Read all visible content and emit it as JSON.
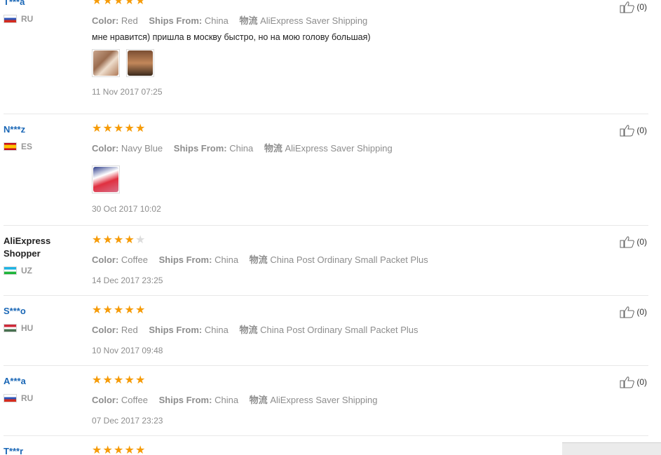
{
  "reviews": [
    {
      "user": "T***a",
      "country": "RU",
      "flag": "ru",
      "rating": 5,
      "color_label": "Color:",
      "color": "Red",
      "ships_label": "Ships From:",
      "ships": "China",
      "logistics_label": "物流",
      "logistics": "AliExpress Saver Shipping",
      "text": "мне нравится) пришла в москву быстро, но на мою голову большая)",
      "photos": [
        "photo-1",
        "photo-2"
      ],
      "date": "11 Nov 2017 07:25",
      "likes": "(0)"
    },
    {
      "user": "N***z",
      "country": "ES",
      "flag": "es",
      "rating": 5,
      "color_label": "Color:",
      "color": "Navy Blue",
      "ships_label": "Ships From:",
      "ships": "China",
      "logistics_label": "物流",
      "logistics": "AliExpress Saver Shipping",
      "text": "",
      "photos": [
        "photo-3"
      ],
      "date": "30 Oct 2017 10:02",
      "likes": "(0)"
    },
    {
      "user": "AliExpress Shopper",
      "country": "UZ",
      "flag": "uz",
      "rating": 4,
      "color_label": "Color:",
      "color": "Coffee",
      "ships_label": "Ships From:",
      "ships": "China",
      "logistics_label": "物流",
      "logistics": "China Post Ordinary Small Packet Plus",
      "text": "",
      "photos": [],
      "date": "14 Dec 2017 23:25",
      "likes": "(0)"
    },
    {
      "user": "S***o",
      "country": "HU",
      "flag": "hu",
      "rating": 5,
      "color_label": "Color:",
      "color": "Red",
      "ships_label": "Ships From:",
      "ships": "China",
      "logistics_label": "物流",
      "logistics": "China Post Ordinary Small Packet Plus",
      "text": "",
      "photos": [],
      "date": "10 Nov 2017 09:48",
      "likes": "(0)"
    },
    {
      "user": "A***a",
      "country": "RU",
      "flag": "ru",
      "rating": 5,
      "color_label": "Color:",
      "color": "Coffee",
      "ships_label": "Ships From:",
      "ships": "China",
      "logistics_label": "物流",
      "logistics": "AliExpress Saver Shipping",
      "text": "",
      "photos": [],
      "date": "07 Dec 2017 23:23",
      "likes": "(0)"
    },
    {
      "user": "T***r",
      "country": "",
      "flag": "",
      "rating": 5,
      "color_label": "",
      "color": "",
      "ships_label": "",
      "ships": "",
      "logistics_label": "",
      "logistics": "",
      "text": "",
      "photos": [],
      "date": "",
      "likes": ""
    }
  ],
  "star_color": "#f69b07",
  "username_color": "#1a67b6",
  "icons": {
    "star": "star-icon",
    "like": "thumbs-up-icon",
    "flag": "flag-icon"
  }
}
